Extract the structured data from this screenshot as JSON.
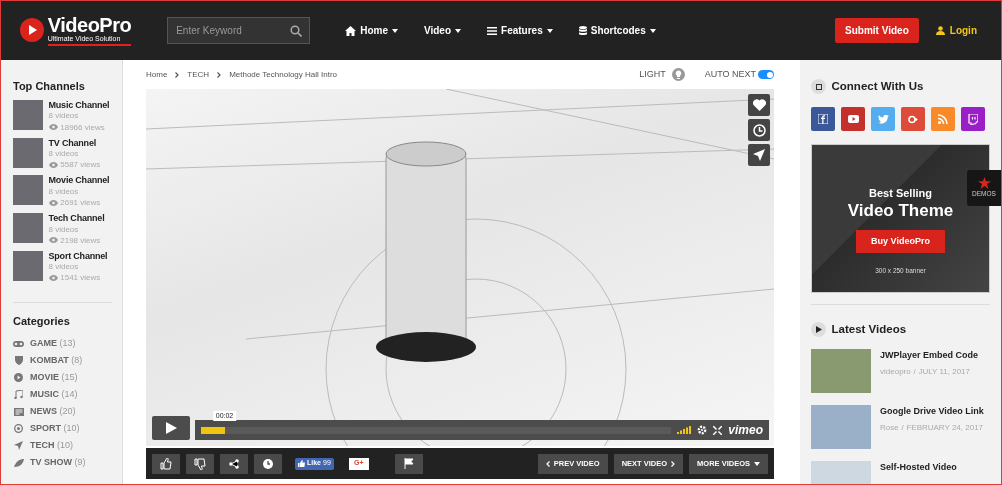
{
  "header": {
    "logo": {
      "name": "VideoPro",
      "tagline": "Ultimate Video Solution"
    },
    "search": {
      "placeholder": "Enter Keyword"
    },
    "nav": [
      {
        "label": "Home"
      },
      {
        "label": "Video"
      },
      {
        "label": "Features"
      },
      {
        "label": "Shortcodes"
      }
    ],
    "submit_button": "Submit Video",
    "login": "Login"
  },
  "left_sidebar": {
    "top_channels_title": "Top Channels",
    "channels": [
      {
        "name": "Music Channel",
        "videos": "8 videos",
        "views": "18966 views"
      },
      {
        "name": "TV Channel",
        "videos": "8 videos",
        "views": "5587 views"
      },
      {
        "name": "Movie Channel",
        "videos": "8 videos",
        "views": "2691 views"
      },
      {
        "name": "Tech Channel",
        "videos": "8 videos",
        "views": "2198 views"
      },
      {
        "name": "Sport Channel",
        "videos": "8 videos",
        "views": "1541 views"
      }
    ],
    "categories_title": "Categories",
    "categories": [
      {
        "label": "GAME",
        "count": "(13)"
      },
      {
        "label": "KOMBAT",
        "count": "(8)"
      },
      {
        "label": "MOVIE",
        "count": "(15)"
      },
      {
        "label": "MUSIC",
        "count": "(14)"
      },
      {
        "label": "NEWS",
        "count": "(20)"
      },
      {
        "label": "SPORT",
        "count": "(10)"
      },
      {
        "label": "TECH",
        "count": "(10)"
      },
      {
        "label": "TV SHOW",
        "count": "(9)"
      }
    ]
  },
  "main": {
    "breadcrumb": [
      "Home",
      "TECH",
      "Methode Technology Hall Intro"
    ],
    "light": {
      "label": "LIGHT"
    },
    "auto_next": {
      "label": "AUTO NEXT",
      "on": true
    },
    "player": {
      "time": "00:02",
      "level": 0.05,
      "brand": "vimeo"
    },
    "actions": {
      "fb_like": "Like",
      "fb_count": "99",
      "gplus": "G+",
      "prev": "PREV VIDEO",
      "next": "NEXT VIDEO",
      "more": "MORE VIDEOS"
    }
  },
  "right_sidebar": {
    "connect_title": "Connect With Us",
    "socials": [
      {
        "color": "#3b5998"
      },
      {
        "color": "#c4302b"
      },
      {
        "color": "#55acee"
      },
      {
        "color": "#dd4b39"
      },
      {
        "color": "#f88a2a"
      },
      {
        "color": "#9b1fc6"
      }
    ],
    "banner": {
      "line_1": "Best Selling",
      "line_2": "Video Theme",
      "button": "Buy VideoPro",
      "caption": "300 x 250 banner"
    },
    "demos": "DEMOS",
    "latest_title": "Latest Videos",
    "latest": [
      {
        "title": "JWPlayer Embed Code",
        "author": "videopro",
        "separator": "/",
        "date": "JULY 11, 2017"
      },
      {
        "title": "Google Drive Video Link",
        "author": "Rose",
        "separator": "/",
        "date": "FEBRUARY 24, 2017"
      },
      {
        "title": "Self-Hosted Video"
      }
    ]
  }
}
